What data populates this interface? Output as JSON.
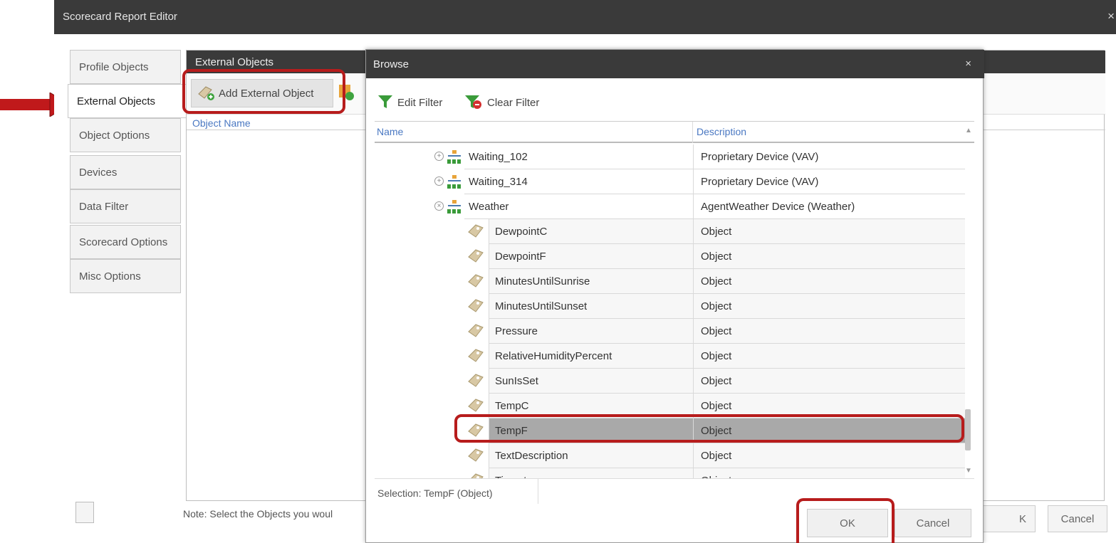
{
  "editor": {
    "title": "Scorecard Report Editor",
    "close_glyph": "×"
  },
  "nav": {
    "tabs": [
      {
        "label": "Profile Objects"
      },
      {
        "label": "External Objects"
      },
      {
        "label": "Object Options"
      },
      {
        "label": "Devices"
      },
      {
        "label": "Data Filter"
      },
      {
        "label": "Scorecard Options"
      },
      {
        "label": "Misc Options"
      }
    ],
    "active_index": 1
  },
  "external_panel": {
    "title": "External Objects",
    "add_button": "Add External Object",
    "column_header": "Object Name",
    "note": "Note: Select the Objects you woul",
    "ok_label": "K",
    "cancel_label": "Cancel"
  },
  "browse": {
    "title": "Browse",
    "close_glyph": "×",
    "edit_filter": "Edit Filter",
    "clear_filter": "Clear Filter",
    "columns": {
      "name": "Name",
      "description": "Description"
    },
    "rows": [
      {
        "name": "Waiting_102",
        "description": "Proprietary Device (VAV)",
        "type": "device",
        "expander": "+"
      },
      {
        "name": "Waiting_314",
        "description": "Proprietary Device (VAV)",
        "type": "device",
        "expander": "+"
      },
      {
        "name": "Weather",
        "description": "AgentWeather Device (Weather)",
        "type": "device",
        "expander": "×"
      },
      {
        "name": "DewpointC",
        "description": "Object",
        "type": "object"
      },
      {
        "name": "DewpointF",
        "description": "Object",
        "type": "object"
      },
      {
        "name": "MinutesUntilSunrise",
        "description": "Object",
        "type": "object"
      },
      {
        "name": "MinutesUntilSunset",
        "description": "Object",
        "type": "object"
      },
      {
        "name": "Pressure",
        "description": "Object",
        "type": "object"
      },
      {
        "name": "RelativeHumidityPercent",
        "description": "Object",
        "type": "object"
      },
      {
        "name": "SunIsSet",
        "description": "Object",
        "type": "object"
      },
      {
        "name": "TempC",
        "description": "Object",
        "type": "object"
      },
      {
        "name": "TempF",
        "description": "Object",
        "type": "object",
        "selected": true
      },
      {
        "name": "TextDescription",
        "description": "Object",
        "type": "object"
      },
      {
        "name": "Timestamp",
        "description": "Object",
        "type": "object"
      }
    ],
    "selection": "Selection: TempF (Object)",
    "ok_label": "OK",
    "cancel_label": "Cancel"
  },
  "colors": {
    "titlebar": "#3a3a3a",
    "header_text": "#4a78c2",
    "highlight": "#b71c1c",
    "selected_row": "#a9a9a9"
  }
}
